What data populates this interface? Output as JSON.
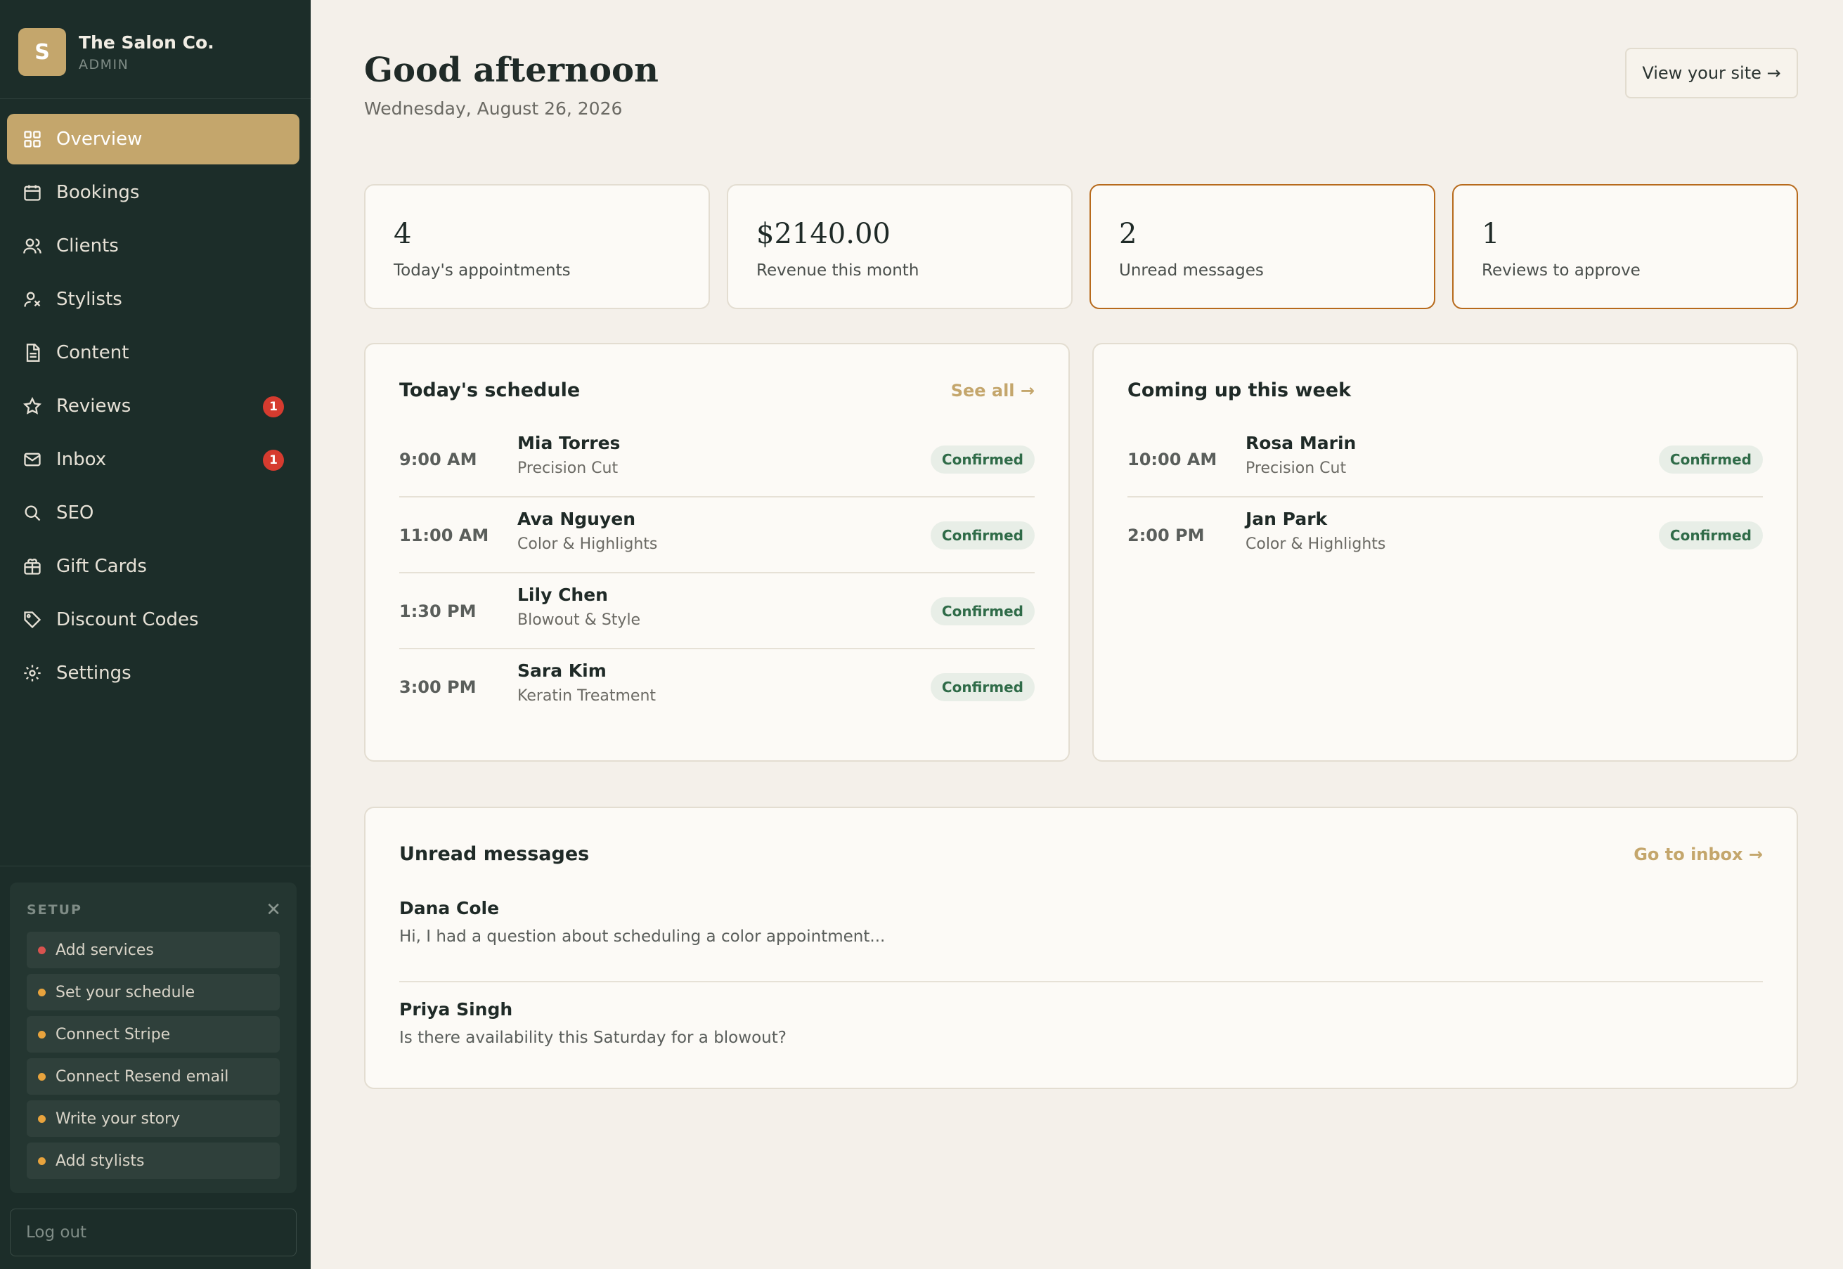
{
  "brand": {
    "logo_letter": "S",
    "name": "The Salon Co.",
    "role": "ADMIN"
  },
  "nav": [
    {
      "label": "Overview",
      "icon": "grid-icon",
      "active": true
    },
    {
      "label": "Bookings",
      "icon": "calendar-icon"
    },
    {
      "label": "Clients",
      "icon": "users-icon"
    },
    {
      "label": "Stylists",
      "icon": "stylist-icon"
    },
    {
      "label": "Content",
      "icon": "document-icon"
    },
    {
      "label": "Reviews",
      "icon": "star-icon",
      "badge": "1"
    },
    {
      "label": "Inbox",
      "icon": "mail-icon",
      "badge": "1"
    },
    {
      "label": "SEO",
      "icon": "search-icon"
    },
    {
      "label": "Gift Cards",
      "icon": "gift-icon"
    },
    {
      "label": "Discount Codes",
      "icon": "tag-icon"
    },
    {
      "label": "Settings",
      "icon": "gear-icon"
    }
  ],
  "setup": {
    "title": "SETUP",
    "items": [
      {
        "label": "Add services",
        "dot_color": "#d9534f"
      },
      {
        "label": "Set your schedule",
        "dot_color": "#e8a33d"
      },
      {
        "label": "Connect Stripe",
        "dot_color": "#e8a33d"
      },
      {
        "label": "Connect Resend email",
        "dot_color": "#e8a33d"
      },
      {
        "label": "Write your story",
        "dot_color": "#e8a33d"
      },
      {
        "label": "Add stylists",
        "dot_color": "#e8a33d"
      }
    ]
  },
  "logout_label": "Log out",
  "header": {
    "greeting": "Good afternoon",
    "date": "Wednesday, August 26, 2026",
    "view_site": "View your site →"
  },
  "stats": [
    {
      "value": "4",
      "label": "Today's appointments",
      "highlight": false
    },
    {
      "value": "$2140.00",
      "label": "Revenue this month",
      "highlight": false
    },
    {
      "value": "2",
      "label": "Unread messages",
      "highlight": true
    },
    {
      "value": "1",
      "label": "Reviews to approve",
      "highlight": true
    }
  ],
  "today_schedule": {
    "title": "Today's schedule",
    "link": "See all →",
    "items": [
      {
        "time": "9:00 AM",
        "name": "Mia Torres",
        "service": "Precision Cut",
        "status": "Confirmed"
      },
      {
        "time": "11:00 AM",
        "name": "Ava Nguyen",
        "service": "Color & Highlights",
        "status": "Confirmed"
      },
      {
        "time": "1:30 PM",
        "name": "Lily Chen",
        "service": "Blowout & Style",
        "status": "Confirmed"
      },
      {
        "time": "3:00 PM",
        "name": "Sara Kim",
        "service": "Keratin Treatment",
        "status": "Confirmed"
      }
    ]
  },
  "week": {
    "title": "Coming up this week",
    "items": [
      {
        "time": "10:00 AM",
        "name": "Rosa Marin",
        "service": "Precision Cut",
        "status": "Confirmed"
      },
      {
        "time": "2:00 PM",
        "name": "Jan Park",
        "service": "Color & Highlights",
        "status": "Confirmed"
      }
    ]
  },
  "messages": {
    "title": "Unread messages",
    "link": "Go to inbox →",
    "items": [
      {
        "name": "Dana Cole",
        "text": "Hi, I had a question about scheduling a color appointment..."
      },
      {
        "name": "Priya Singh",
        "text": "Is there availability this Saturday for a blowout?"
      }
    ]
  },
  "colors": {
    "sidebar": "#1c2d29",
    "accent": "#c4a66c",
    "highlight_border": "#b76a1c",
    "badge": "#d63b2f",
    "confirmed": "#2f6b48"
  }
}
